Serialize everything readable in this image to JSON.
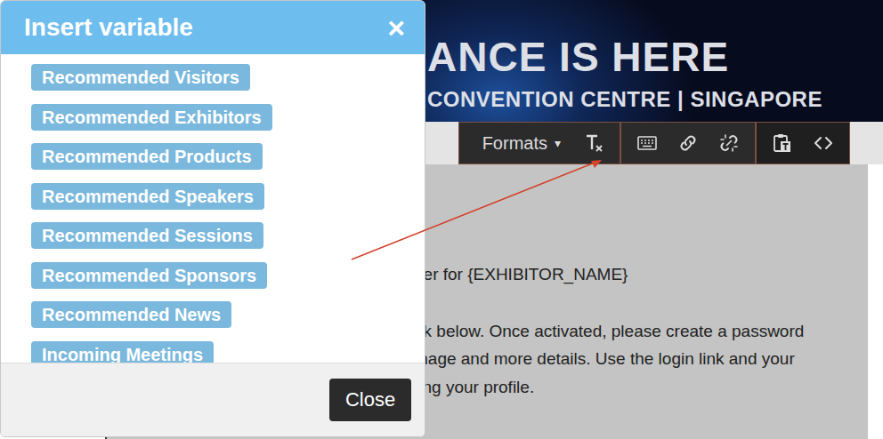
{
  "modal": {
    "title": "Insert variable",
    "close_icon": "×",
    "items": [
      {
        "label": "Recommended Visitors"
      },
      {
        "label": "Recommended Exhibitors"
      },
      {
        "label": "Recommended Products"
      },
      {
        "label": "Recommended Speakers"
      },
      {
        "label": "Recommended Sessions"
      },
      {
        "label": "Recommended Sponsors"
      },
      {
        "label": "Recommended News"
      },
      {
        "label": "Incoming Meetings"
      }
    ],
    "close_button": "Close"
  },
  "banner": {
    "headline": "ANCE IS HERE",
    "subline": "CONVENTION CENTRE | SINGAPORE"
  },
  "toolbar": {
    "formats": "Formats",
    "caret": "▾"
  },
  "editor": {
    "paragraphs": [
      [
        "ber for {EXHIBITOR_NAME}"
      ],
      [
        "nk below. Once activated, please create a password",
        "mage and more details. Use the login link and your",
        "ting your profile."
      ]
    ]
  }
}
